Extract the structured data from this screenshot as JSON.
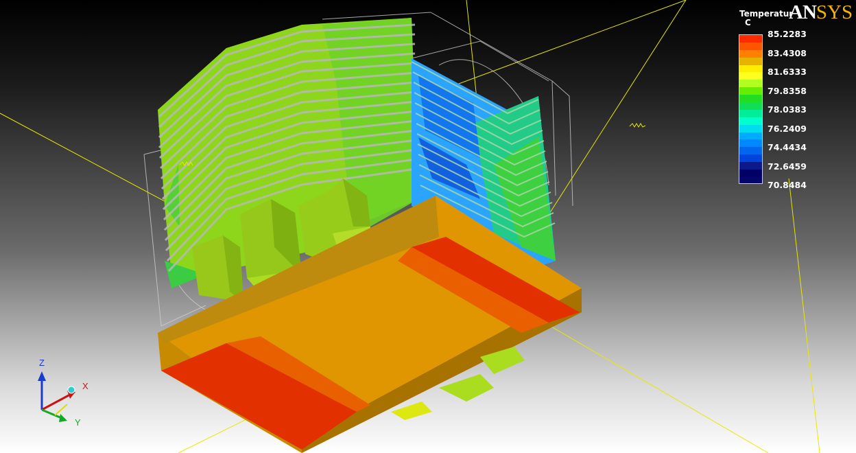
{
  "legend": {
    "title": "Temperatur",
    "unit": "C",
    "labels": [
      "85.2283",
      "83.4308",
      "81.6333",
      "79.8358",
      "78.0383",
      "76.2409",
      "74.4434",
      "72.6459",
      "70.8484"
    ],
    "colors": [
      "#ff2a00",
      "#ff5500",
      "#ff8000",
      "#e6b400",
      "#ffee00",
      "#ffff20",
      "#b0ff20",
      "#66ee00",
      "#22dd22",
      "#11dd55",
      "#00ee99",
      "#00ffcc",
      "#00ddee",
      "#00aaff",
      "#0088ff",
      "#0066ee",
      "#0044dd",
      "#0a1a8a",
      "#000066",
      "#06056b"
    ]
  },
  "logo": {
    "an": "AN",
    "sys": "SYS"
  },
  "axes": {
    "z": "Z",
    "x": "X",
    "y": "Y"
  }
}
